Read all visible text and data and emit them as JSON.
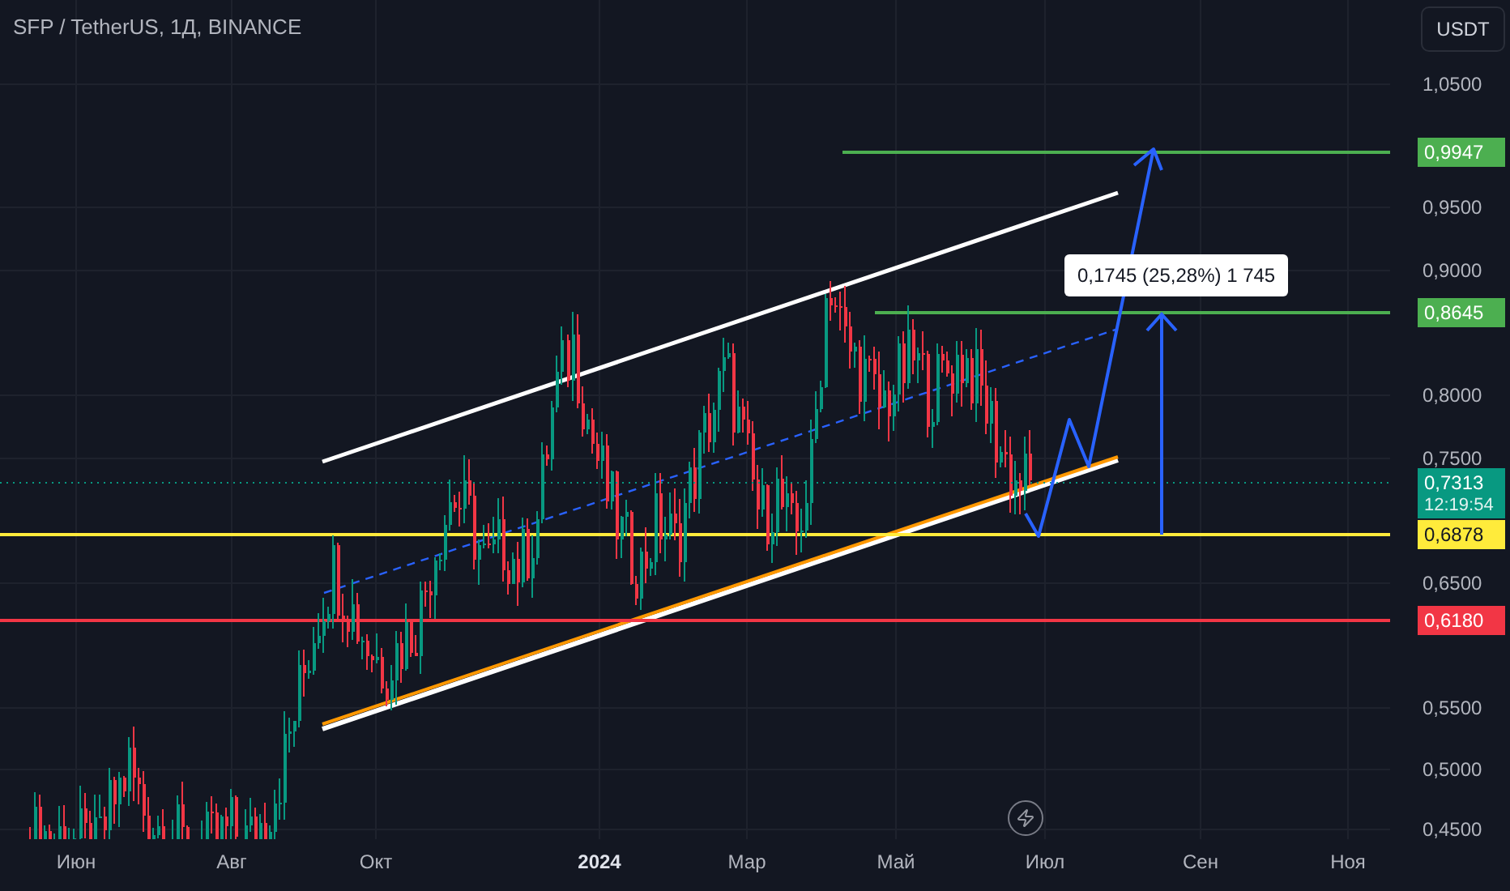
{
  "header": {
    "title": "SFP / TetherUS, 1Д, BINANCE"
  },
  "currency_button": {
    "label": "USDT"
  },
  "price_axis": [
    "1,0500",
    "0,9500",
    "0,9000",
    "0,8000",
    "0,7500",
    "0,6500",
    "0,5500",
    "0,5000",
    "0,4500"
  ],
  "price_levels": [
    {
      "label": "0,9947",
      "color": "#4caf50"
    },
    {
      "label": "0,8645",
      "color": "#4caf50"
    },
    {
      "label": "0,6878",
      "color": "#ffeb3b"
    },
    {
      "label": "0,6180",
      "color": "#f23645"
    }
  ],
  "last_price": {
    "price": "0,7313",
    "countdown": "12:19:54"
  },
  "measure_label": "0,1745 (25,28%) 1 745",
  "time_axis": [
    {
      "label": "Июн",
      "kind": "month"
    },
    {
      "label": "Авг",
      "kind": "month"
    },
    {
      "label": "Окт",
      "kind": "month"
    },
    {
      "label": "2024",
      "kind": "year"
    },
    {
      "label": "Мар",
      "kind": "month"
    },
    {
      "label": "Май",
      "kind": "month"
    },
    {
      "label": "Июл",
      "kind": "month"
    },
    {
      "label": "Сен",
      "kind": "month"
    },
    {
      "label": "Ноя",
      "kind": "month"
    }
  ]
}
